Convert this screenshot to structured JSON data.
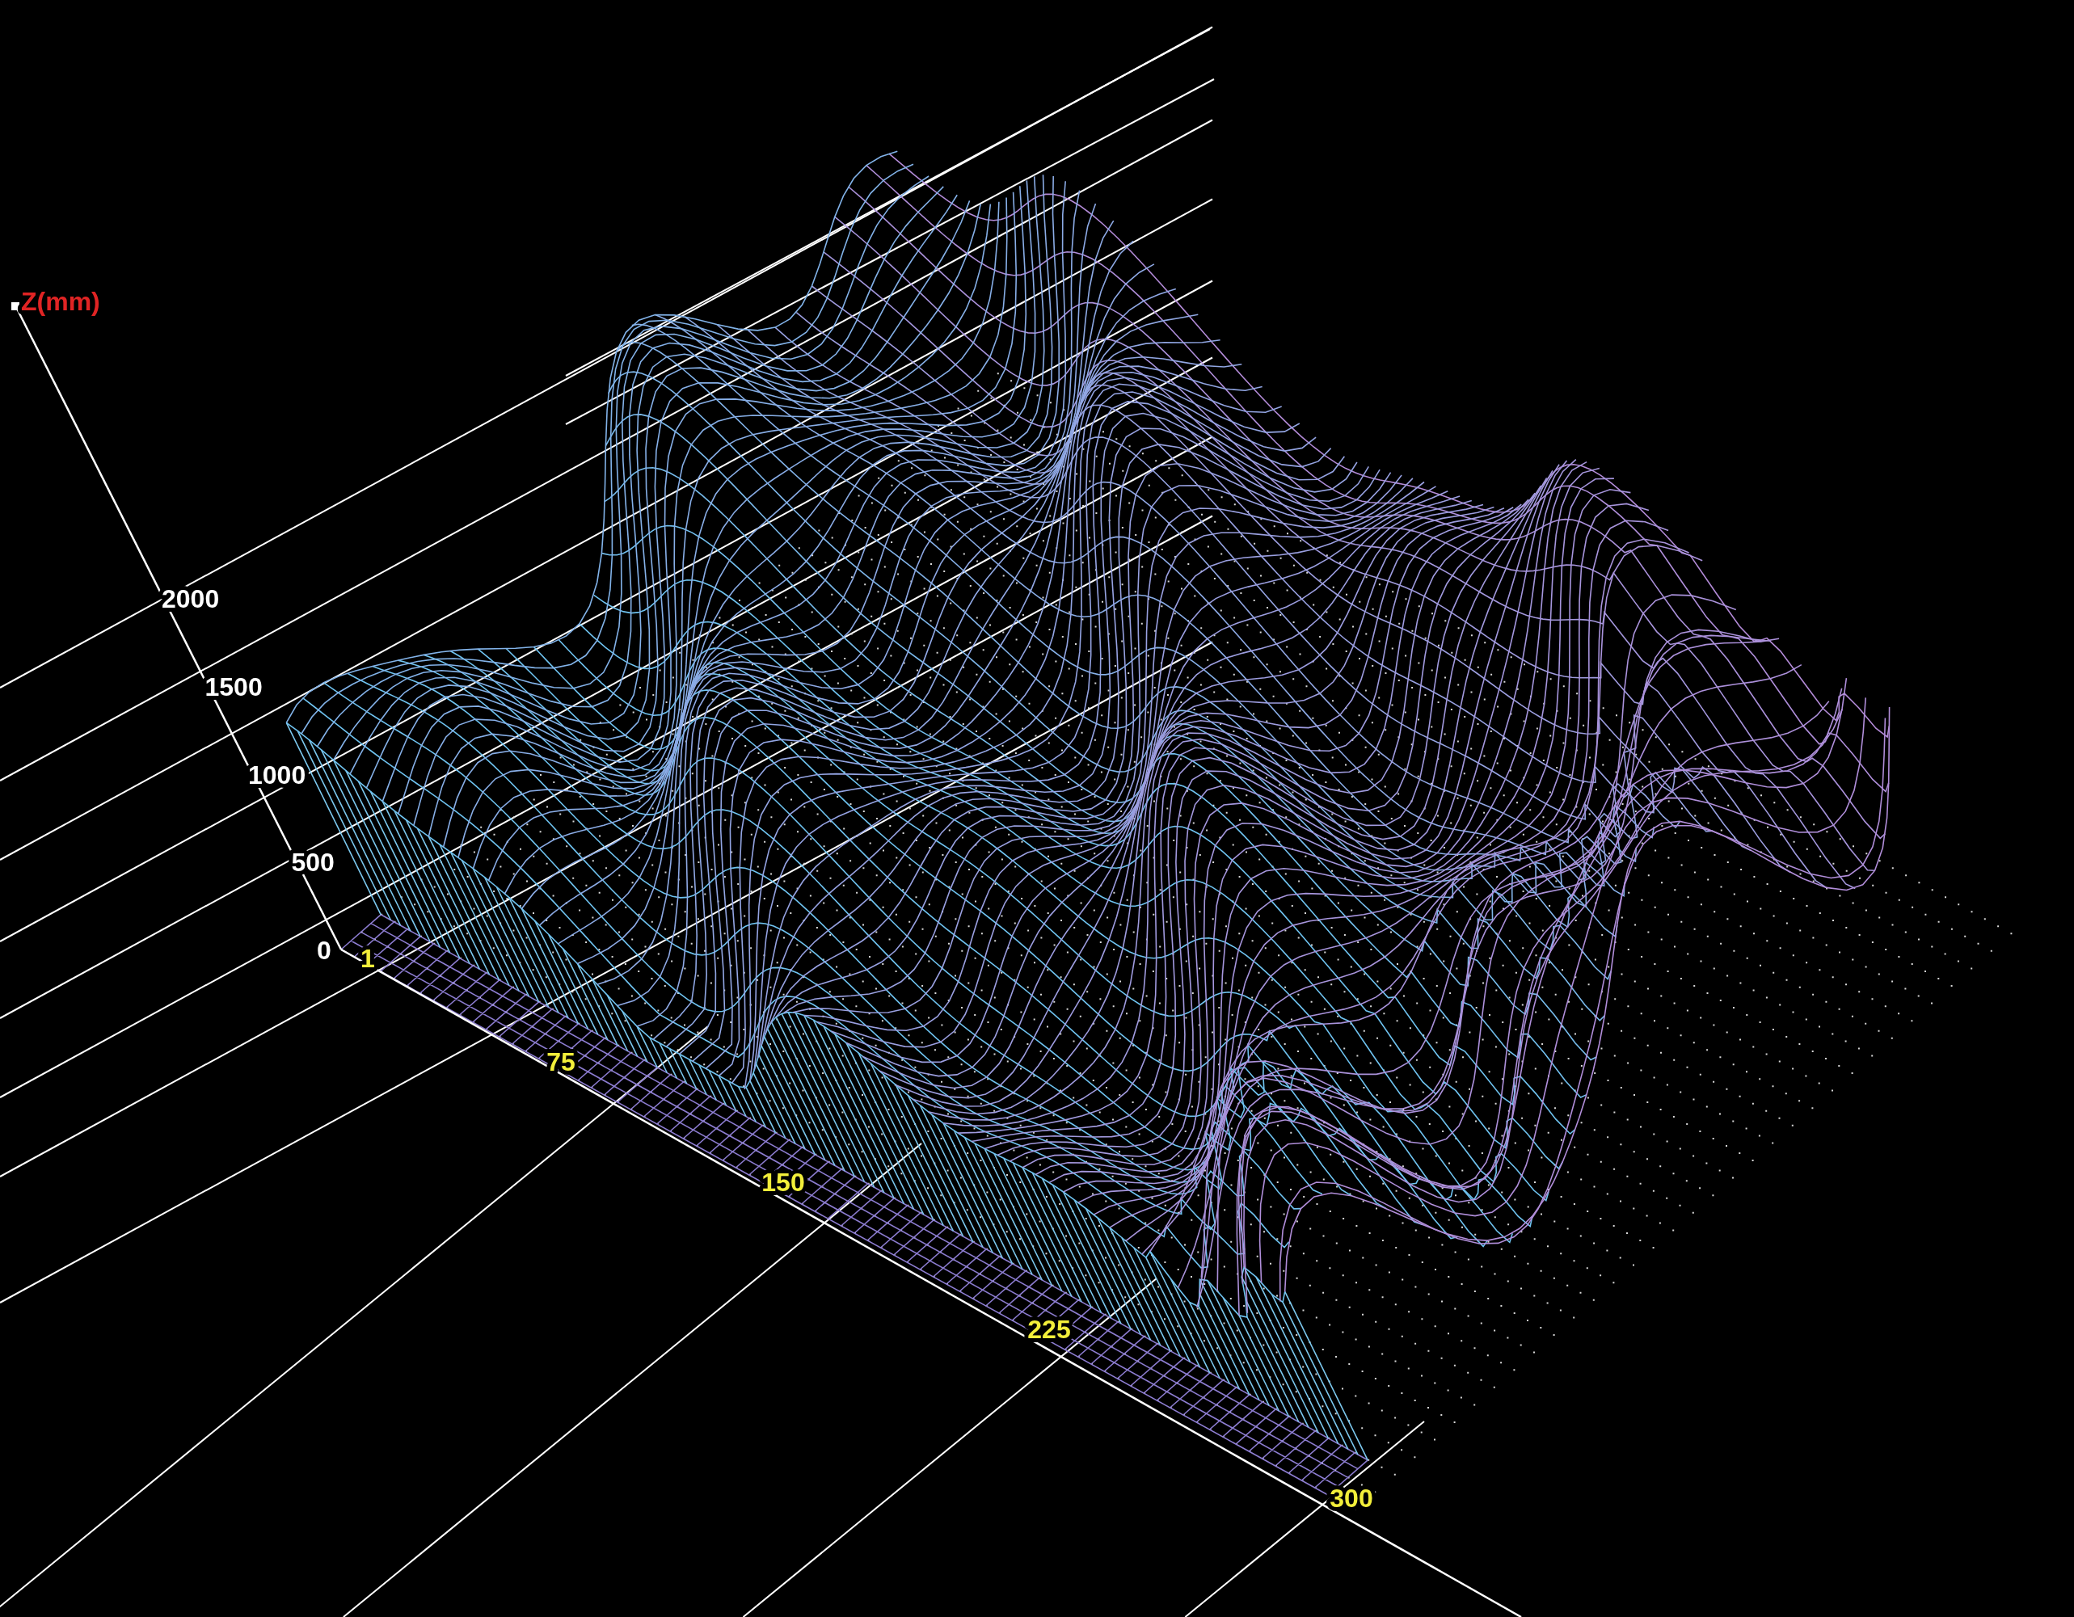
{
  "plot": {
    "z_axis_label": "Z(mm)",
    "z_ticks": [
      "0",
      "500",
      "1000",
      "1500",
      "2000"
    ],
    "x_ticks": [
      "1",
      "75",
      "150",
      "225",
      "300"
    ]
  }
}
